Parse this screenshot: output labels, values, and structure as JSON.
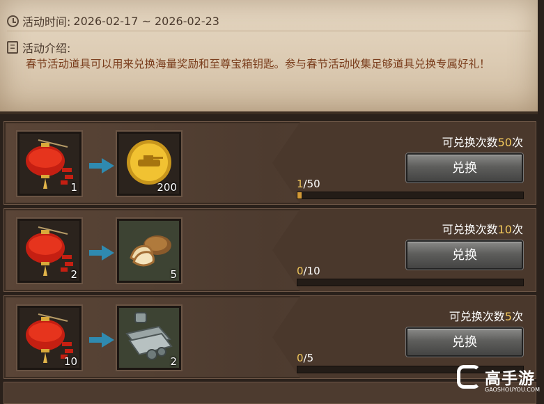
{
  "activity_time": {
    "label": "活动时间:",
    "value": "2026-02-17 ~ 2026-02-23"
  },
  "activity_intro": {
    "label": "活动介绍:",
    "text": "春节活动道具可以用来兑换海量奖励和至尊宝箱钥匙。参与春节活动收集足够道具兑换专属好礼！"
  },
  "exchanges": [
    {
      "cost_item": "lantern-icon",
      "cost_qty": "1",
      "reward_item": "gold-coin-icon",
      "reward_qty": "200",
      "times_prefix": "可兑换次数",
      "times_num": "50",
      "times_suffix": "次",
      "button": "兑换",
      "progress_current": "1",
      "progress_total": "/50",
      "progress_fraction": 0.02
    },
    {
      "cost_item": "lantern-icon",
      "cost_qty": "2",
      "reward_item": "bread-icon",
      "reward_qty": "5",
      "times_prefix": "可兑换次数",
      "times_num": "10",
      "times_suffix": "次",
      "button": "兑换",
      "progress_current": "0",
      "progress_total": "/10",
      "progress_fraction": 0
    },
    {
      "cost_item": "lantern-icon",
      "cost_qty": "10",
      "reward_item": "steel-parts-icon",
      "reward_qty": "2",
      "times_prefix": "可兑换次数",
      "times_num": "5",
      "times_suffix": "次",
      "button": "兑换",
      "progress_current": "0",
      "progress_total": "/5",
      "progress_fraction": 0
    }
  ],
  "watermark": {
    "brand": "高手游",
    "url": "GAOSHOUYOU.COM"
  },
  "colors": {
    "highlight": "#f3c95c",
    "description": "#7a3d1c",
    "arrow": "#2f8ab0"
  }
}
